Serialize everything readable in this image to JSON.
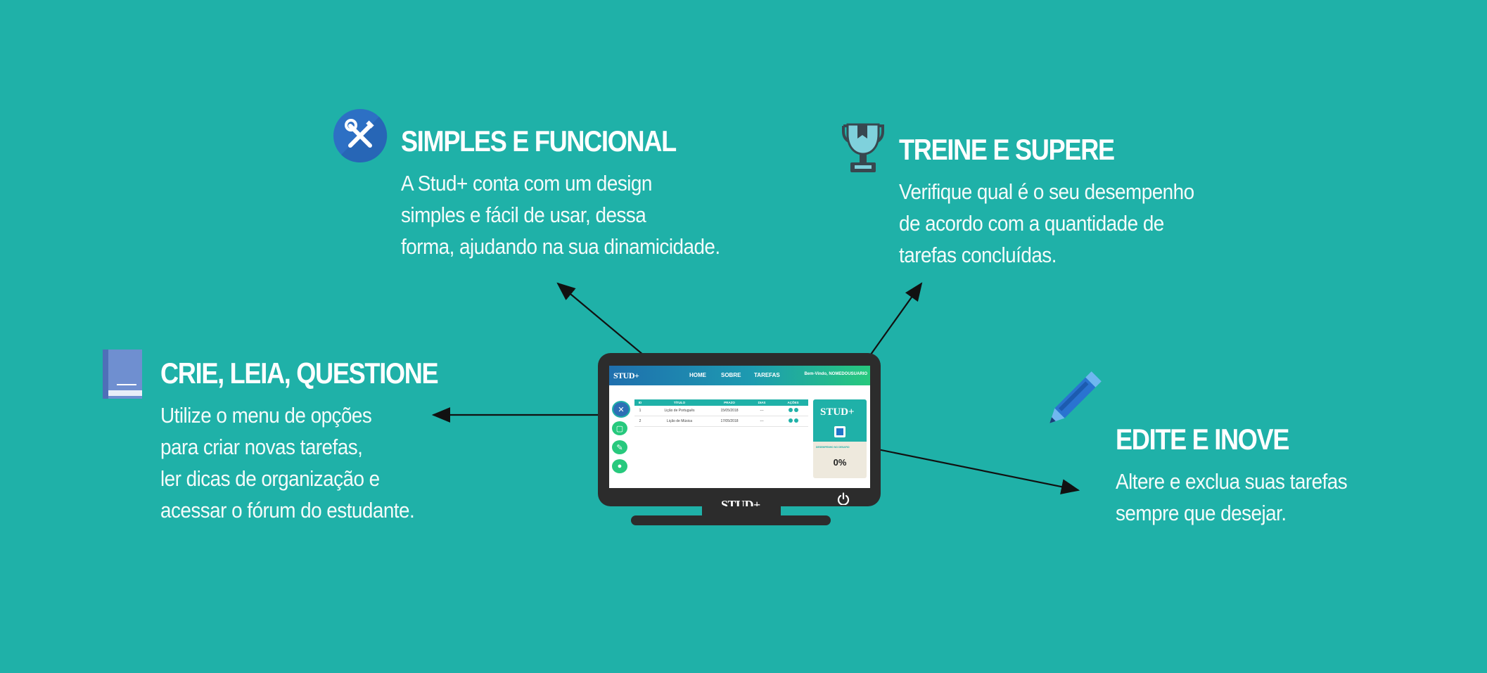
{
  "features": {
    "simples": {
      "title": "SIMPLES E  FUNCIONAL",
      "lines": [
        "A Stud+ conta com um design",
        "simples e fácil de usar, dessa",
        "forma, ajudando na sua dinamicidade."
      ]
    },
    "treine": {
      "title": "TREINE E SUPERE",
      "lines": [
        "Verifique qual é o seu desempenho",
        "de acordo com a quantidade de",
        "tarefas concluídas."
      ]
    },
    "crie": {
      "title": "CRIE, LEIA, QUESTIONE",
      "lines": [
        "Utilize o menu de opções",
        "para criar novas tarefas,",
        "ler dicas de organização e",
        "acessar o fórum do estudante."
      ]
    },
    "edite": {
      "title": "EDITE E INOVE",
      "lines": [
        "Altere e exclua suas tarefas",
        "sempre que desejar."
      ]
    }
  },
  "icons": {
    "simples": "tools-icon",
    "treine": "trophy-icon",
    "crie": "book-icon",
    "edite": "pencil-icon"
  },
  "colors": {
    "background": "#1fb1a8",
    "monitor": "#2c2c2c",
    "accent_blue": "#2176c7",
    "accent_green": "#27c97d"
  },
  "mockup": {
    "logo": "STUD+",
    "nav": [
      "HOME",
      "SOBRE",
      "TAREFAS"
    ],
    "welcome": "Bem-Vindo, NOMEDOUSUARIO",
    "table": {
      "headers": [
        "ID",
        "TÍTULO",
        "PRAZO",
        "DIAS",
        "AÇÕES"
      ],
      "rows": [
        [
          "1",
          "Lição de Português",
          "15/05/2018",
          "---"
        ],
        [
          "2",
          "Lição de Música",
          "17/05/2018",
          "---"
        ]
      ]
    },
    "card_logo": "STUD+",
    "card_label": "DESEMPENHO NO DESAFIO",
    "percent": "0%",
    "brand": "STUD+"
  }
}
